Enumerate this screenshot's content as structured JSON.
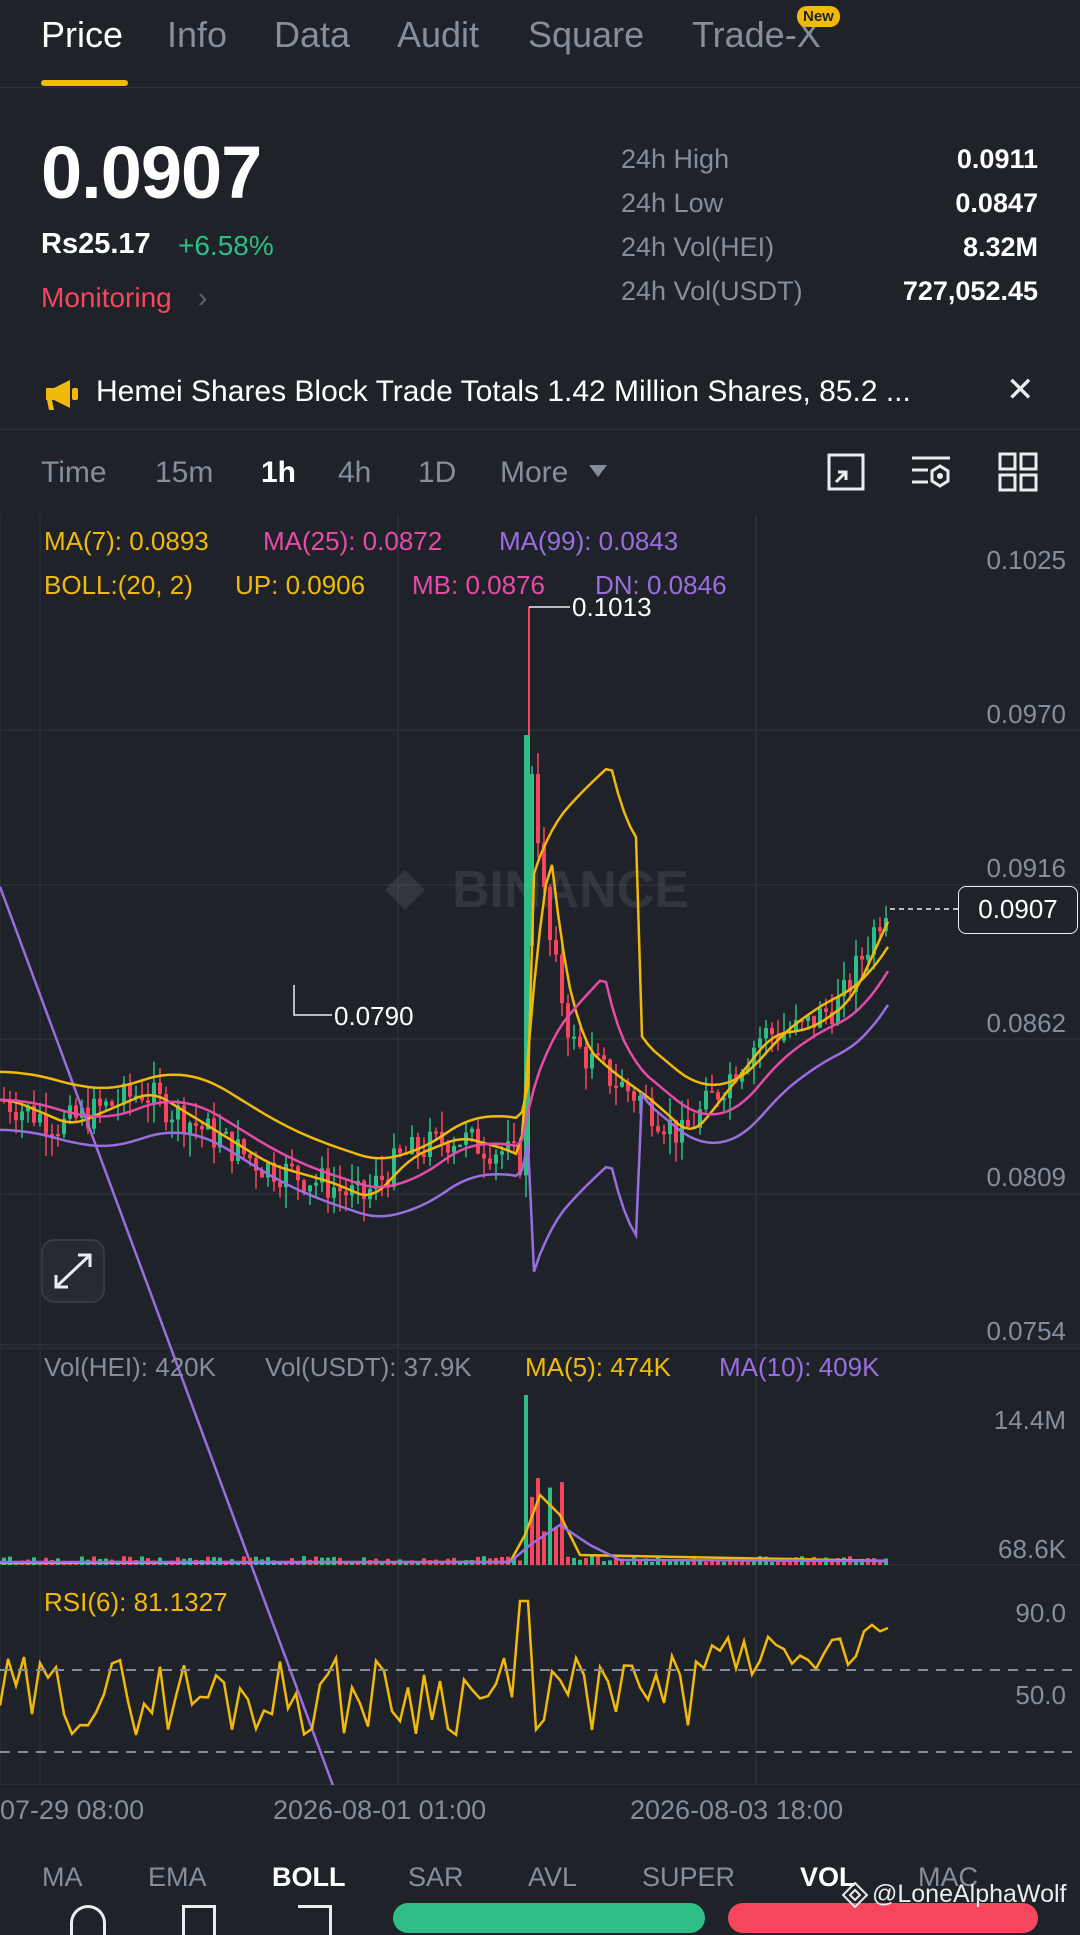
{
  "tabs": [
    {
      "label": "Price",
      "active": true
    },
    {
      "label": "Info"
    },
    {
      "label": "Data"
    },
    {
      "label": "Audit"
    },
    {
      "label": "Square"
    },
    {
      "label": "Trade-X",
      "badge": "New"
    }
  ],
  "ticker": {
    "price": "0.0907",
    "fiat_price": "Rs25.17",
    "change": "+6.58%",
    "monitoring": "Monitoring",
    "stats": [
      {
        "label": "24h High",
        "value": "0.0911"
      },
      {
        "label": "24h Low",
        "value": "0.0847"
      },
      {
        "label": "24h Vol(HEI)",
        "value": "8.32M"
      },
      {
        "label": "24h Vol(USDT)",
        "value": "727,052.45"
      }
    ]
  },
  "banner": {
    "text": "Hemei Shares Block Trade Totals 1.42 Million Shares, 85.2 ..."
  },
  "intervals": [
    {
      "label": "Time"
    },
    {
      "label": "15m"
    },
    {
      "label": "1h",
      "active": true
    },
    {
      "label": "4h"
    },
    {
      "label": "1D"
    },
    {
      "label": "More"
    }
  ],
  "tool_icons": [
    "chart-settings-icon",
    "indicator-settings-icon",
    "layout-grid-icon"
  ],
  "indicators": {
    "ma7": "MA(7): 0.0893",
    "ma25": "MA(25): 0.0872",
    "ma99": "MA(99): 0.0843",
    "boll": "BOLL:(20, 2)",
    "up": "UP: 0.0906",
    "mb": "MB: 0.0876",
    "dn": "DN: 0.0846",
    "vol_hei": "Vol(HEI): 420K",
    "vol_usdt": "Vol(USDT): 37.9K",
    "vol_ma5": "MA(5): 474K",
    "vol_ma10": "MA(10): 409K",
    "rsi": "RSI(6): 81.1327"
  },
  "price_axis": [
    "0.1025",
    "0.0970",
    "0.0916",
    "0.0862",
    "0.0809",
    "0.0754"
  ],
  "volume_axis": [
    "14.4M",
    "68.6K"
  ],
  "rsi_axis": [
    "90.0",
    "50.0"
  ],
  "current_price_tag": "0.0907",
  "high_marker": "0.1013",
  "low_marker": "0.0790",
  "watermark": "BINANCE",
  "dates": [
    "07-29 08:00",
    "2026-08-01 01:00",
    "2026-08-03 18:00"
  ],
  "bottom_tabs": [
    {
      "label": "MA"
    },
    {
      "label": "EMA"
    },
    {
      "label": "BOLL",
      "active": true
    },
    {
      "label": "SAR"
    },
    {
      "label": "AVL"
    },
    {
      "label": "SUPER"
    },
    {
      "label": "VOL",
      "active": true
    },
    {
      "label": "MAC"
    }
  ],
  "credit": "@LoneAlphaWolf",
  "colors": {
    "up": "#2ebd85",
    "down": "#f6465d",
    "ma7": "#f0b90b",
    "ma25": "#e64ba8",
    "ma99": "#9a6ee0",
    "boll": "#f0b90b",
    "background": "#1f2329"
  }
}
